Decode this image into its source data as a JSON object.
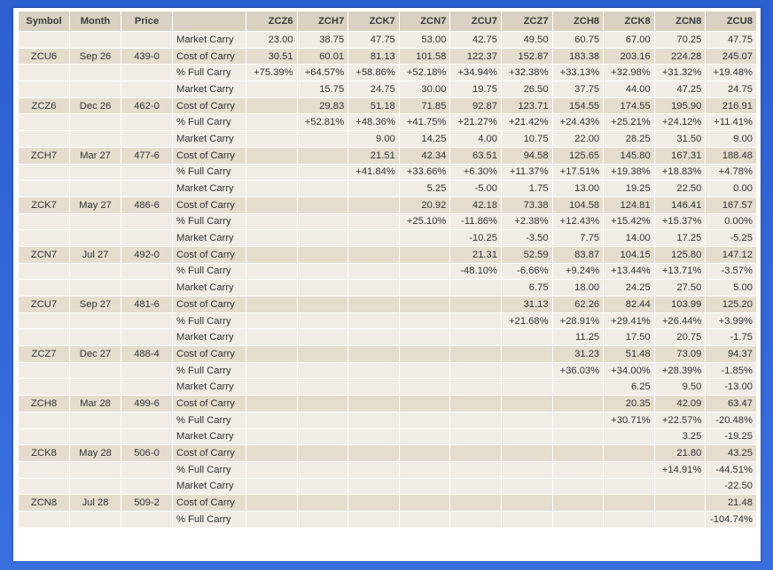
{
  "columns": {
    "symbol": "Symbol",
    "month": "Month",
    "price": "Price",
    "label": "",
    "contracts": [
      "ZCZ6",
      "ZCH7",
      "ZCK7",
      "ZCN7",
      "ZCU7",
      "ZCZ7",
      "ZCH8",
      "ZCK8",
      "ZCN8",
      "ZCU8"
    ]
  },
  "row_labels": {
    "market": "Market Carry",
    "cost": "Cost of Carry",
    "pct": "% Full Carry"
  },
  "colors": {
    "positive": "#1ea83a",
    "negative": "#e02424",
    "header_bg": "#d9d2c3",
    "row_dark": "#e4ddce",
    "row_light": "#f1ede6"
  },
  "groups": [
    {
      "symbol": "ZCU6",
      "month": "Sep 26",
      "price": "439-0",
      "market": [
        "23.00",
        "38.75",
        "47.75",
        "53.00",
        "42.75",
        "49.50",
        "60.75",
        "67.00",
        "70.25",
        "47.75"
      ],
      "cost": [
        "30.51",
        "60.01",
        "81.13",
        "101.58",
        "122.37",
        "152.87",
        "183.38",
        "203.16",
        "224.28",
        "245.07"
      ],
      "pct": [
        "+75.39%",
        "+64.57%",
        "+58.86%",
        "+52.18%",
        "+34.94%",
        "+32.38%",
        "+33.13%",
        "+32.98%",
        "+31.32%",
        "+19.48%"
      ]
    },
    {
      "symbol": "ZCZ6",
      "month": "Dec 26",
      "price": "462-0",
      "market": [
        "",
        "15.75",
        "24.75",
        "30.00",
        "19.75",
        "26.50",
        "37.75",
        "44.00",
        "47.25",
        "24.75"
      ],
      "cost": [
        "",
        "29.83",
        "51.18",
        "71.85",
        "92.87",
        "123.71",
        "154.55",
        "174.55",
        "195.90",
        "216.91"
      ],
      "pct": [
        "",
        "+52.81%",
        "+48.36%",
        "+41.75%",
        "+21.27%",
        "+21.42%",
        "+24.43%",
        "+25.21%",
        "+24.12%",
        "+11.41%"
      ]
    },
    {
      "symbol": "ZCH7",
      "month": "Mar 27",
      "price": "477-6",
      "market": [
        "",
        "",
        "9.00",
        "14.25",
        "4.00",
        "10.75",
        "22.00",
        "28.25",
        "31.50",
        "9.00"
      ],
      "cost": [
        "",
        "",
        "21.51",
        "42.34",
        "63.51",
        "94.58",
        "125.65",
        "145.80",
        "167.31",
        "188.48"
      ],
      "pct": [
        "",
        "",
        "+41.84%",
        "+33.66%",
        "+6.30%",
        "+11.37%",
        "+17.51%",
        "+19.38%",
        "+18.83%",
        "+4.78%"
      ]
    },
    {
      "symbol": "ZCK7",
      "month": "May 27",
      "price": "486-6",
      "market": [
        "",
        "",
        "",
        "5.25",
        "-5.00",
        "1.75",
        "13.00",
        "19.25",
        "22.50",
        "0.00"
      ],
      "cost": [
        "",
        "",
        "",
        "20.92",
        "42.18",
        "73.38",
        "104.58",
        "124.81",
        "146.41",
        "167.57"
      ],
      "pct": [
        "",
        "",
        "",
        "+25.10%",
        "-11.86%",
        "+2.38%",
        "+12.43%",
        "+15.42%",
        "+15.37%",
        "0.00%"
      ]
    },
    {
      "symbol": "ZCN7",
      "month": "Jul 27",
      "price": "492-0",
      "market": [
        "",
        "",
        "",
        "",
        "-10.25",
        "-3.50",
        "7.75",
        "14.00",
        "17.25",
        "-5.25"
      ],
      "cost": [
        "",
        "",
        "",
        "",
        "21.31",
        "52.59",
        "83.87",
        "104.15",
        "125.80",
        "147.12"
      ],
      "pct": [
        "",
        "",
        "",
        "",
        "-48.10%",
        "-6.66%",
        "+9.24%",
        "+13.44%",
        "+13.71%",
        "-3.57%"
      ]
    },
    {
      "symbol": "ZCU7",
      "month": "Sep 27",
      "price": "481-6",
      "market": [
        "",
        "",
        "",
        "",
        "",
        "6.75",
        "18.00",
        "24.25",
        "27.50",
        "5.00"
      ],
      "cost": [
        "",
        "",
        "",
        "",
        "",
        "31.13",
        "62.26",
        "82.44",
        "103.99",
        "125.20"
      ],
      "pct": [
        "",
        "",
        "",
        "",
        "",
        "+21.68%",
        "+28.91%",
        "+29.41%",
        "+26.44%",
        "+3.99%"
      ]
    },
    {
      "symbol": "ZCZ7",
      "month": "Dec 27",
      "price": "488-4",
      "market": [
        "",
        "",
        "",
        "",
        "",
        "",
        "11.25",
        "17.50",
        "20.75",
        "-1.75"
      ],
      "cost": [
        "",
        "",
        "",
        "",
        "",
        "",
        "31.23",
        "51.48",
        "73.09",
        "94.37"
      ],
      "pct": [
        "",
        "",
        "",
        "",
        "",
        "",
        "+36.03%",
        "+34.00%",
        "+28.39%",
        "-1.85%"
      ]
    },
    {
      "symbol": "ZCH8",
      "month": "Mar 28",
      "price": "499-6",
      "market": [
        "",
        "",
        "",
        "",
        "",
        "",
        "",
        "6.25",
        "9.50",
        "-13.00"
      ],
      "cost": [
        "",
        "",
        "",
        "",
        "",
        "",
        "",
        "20.35",
        "42.09",
        "63.47"
      ],
      "pct": [
        "",
        "",
        "",
        "",
        "",
        "",
        "",
        "+30.71%",
        "+22.57%",
        "-20.48%"
      ]
    },
    {
      "symbol": "ZCK8",
      "month": "May 28",
      "price": "506-0",
      "market": [
        "",
        "",
        "",
        "",
        "",
        "",
        "",
        "",
        "3.25",
        "-19.25"
      ],
      "cost": [
        "",
        "",
        "",
        "",
        "",
        "",
        "",
        "",
        "21.80",
        "43.25"
      ],
      "pct": [
        "",
        "",
        "",
        "",
        "",
        "",
        "",
        "",
        "+14.91%",
        "-44.51%"
      ]
    },
    {
      "symbol": "ZCN8",
      "month": "Jul 28",
      "price": "509-2",
      "market": [
        "",
        "",
        "",
        "",
        "",
        "",
        "",
        "",
        "",
        "-22.50"
      ],
      "cost": [
        "",
        "",
        "",
        "",
        "",
        "",
        "",
        "",
        "",
        "21.48"
      ],
      "pct": [
        "",
        "",
        "",
        "",
        "",
        "",
        "",
        "",
        "",
        "-104.74%"
      ]
    }
  ]
}
